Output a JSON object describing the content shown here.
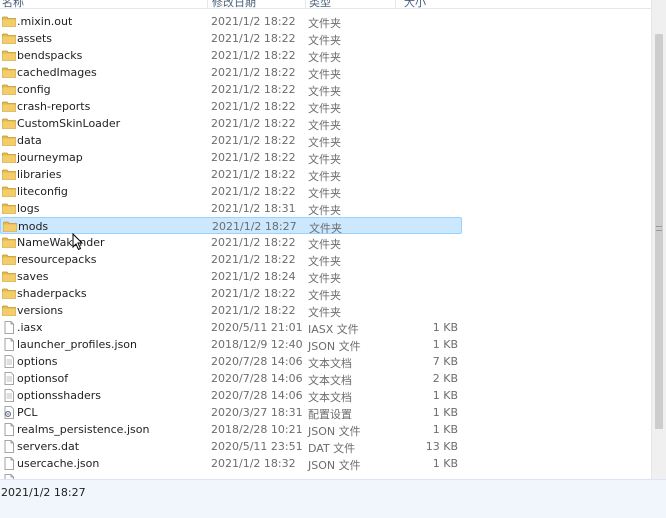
{
  "columns": {
    "name": "名称",
    "date": "修改日期",
    "type": "类型",
    "size": "大小"
  },
  "files": [
    {
      "name": ".mixin.out",
      "date": "2021/1/2 18:22",
      "type": "文件夹",
      "size": "",
      "icon": "folder-icon"
    },
    {
      "name": "assets",
      "date": "2021/1/2 18:22",
      "type": "文件夹",
      "size": "",
      "icon": "folder-icon"
    },
    {
      "name": "bendspacks",
      "date": "2021/1/2 18:22",
      "type": "文件夹",
      "size": "",
      "icon": "folder-icon"
    },
    {
      "name": "cachedImages",
      "date": "2021/1/2 18:22",
      "type": "文件夹",
      "size": "",
      "icon": "folder-icon"
    },
    {
      "name": "config",
      "date": "2021/1/2 18:22",
      "type": "文件夹",
      "size": "",
      "icon": "folder-icon"
    },
    {
      "name": "crash-reports",
      "date": "2021/1/2 18:22",
      "type": "文件夹",
      "size": "",
      "icon": "folder-icon"
    },
    {
      "name": "CustomSkinLoader",
      "date": "2021/1/2 18:22",
      "type": "文件夹",
      "size": "",
      "icon": "folder-icon"
    },
    {
      "name": "data",
      "date": "2021/1/2 18:22",
      "type": "文件夹",
      "size": "",
      "icon": "folder-icon"
    },
    {
      "name": "journeymap",
      "date": "2021/1/2 18:22",
      "type": "文件夹",
      "size": "",
      "icon": "folder-icon"
    },
    {
      "name": "libraries",
      "date": "2021/1/2 18:22",
      "type": "文件夹",
      "size": "",
      "icon": "folder-icon"
    },
    {
      "name": "liteconfig",
      "date": "2021/1/2 18:22",
      "type": "文件夹",
      "size": "",
      "icon": "folder-icon"
    },
    {
      "name": "logs",
      "date": "2021/1/2 18:31",
      "type": "文件夹",
      "size": "",
      "icon": "folder-icon"
    },
    {
      "name": "mods",
      "date": "2021/1/2 18:27",
      "type": "文件夹",
      "size": "",
      "icon": "folder-icon",
      "selected": true
    },
    {
      "name": "NameWakander",
      "date": "2021/1/2 18:22",
      "type": "文件夹",
      "size": "",
      "icon": "folder-icon"
    },
    {
      "name": "resourcepacks",
      "date": "2021/1/2 18:22",
      "type": "文件夹",
      "size": "",
      "icon": "folder-icon"
    },
    {
      "name": "saves",
      "date": "2021/1/2 18:24",
      "type": "文件夹",
      "size": "",
      "icon": "folder-icon"
    },
    {
      "name": "shaderpacks",
      "date": "2021/1/2 18:22",
      "type": "文件夹",
      "size": "",
      "icon": "folder-icon"
    },
    {
      "name": "versions",
      "date": "2021/1/2 18:22",
      "type": "文件夹",
      "size": "",
      "icon": "folder-icon"
    },
    {
      "name": ".iasx",
      "date": "2020/5/11 21:01",
      "type": "IASX 文件",
      "size": "1 KB",
      "icon": "file-icon"
    },
    {
      "name": "launcher_profiles.json",
      "date": "2018/12/9 12:40",
      "type": "JSON 文件",
      "size": "1 KB",
      "icon": "file-icon"
    },
    {
      "name": "options",
      "date": "2020/7/28 14:06",
      "type": "文本文档",
      "size": "7 KB",
      "icon": "text-file-icon"
    },
    {
      "name": "optionsof",
      "date": "2020/7/28 14:06",
      "type": "文本文档",
      "size": "2 KB",
      "icon": "text-file-icon"
    },
    {
      "name": "optionsshaders",
      "date": "2020/7/28 14:06",
      "type": "文本文档",
      "size": "1 KB",
      "icon": "text-file-icon"
    },
    {
      "name": "PCL",
      "date": "2020/3/27 18:31",
      "type": "配置设置",
      "size": "1 KB",
      "icon": "settings-file-icon"
    },
    {
      "name": "realms_persistence.json",
      "date": "2018/2/28 10:21",
      "type": "JSON 文件",
      "size": "1 KB",
      "icon": "file-icon"
    },
    {
      "name": "servers.dat",
      "date": "2020/5/11 23:51",
      "type": "DAT 文件",
      "size": "13 KB",
      "icon": "file-icon"
    },
    {
      "name": "usercache.json",
      "date": "2021/1/2 18:32",
      "type": "JSON 文件",
      "size": "1 KB",
      "icon": "file-icon"
    },
    {
      "name": "",
      "date": "",
      "type": "",
      "size": "",
      "icon": "file-icon"
    }
  ],
  "status": {
    "text": "2021/1/2 18:27"
  },
  "colors": {
    "folder": "#e8b84a",
    "selection": "#cce8ff",
    "selection_border": "#99d1ff"
  }
}
